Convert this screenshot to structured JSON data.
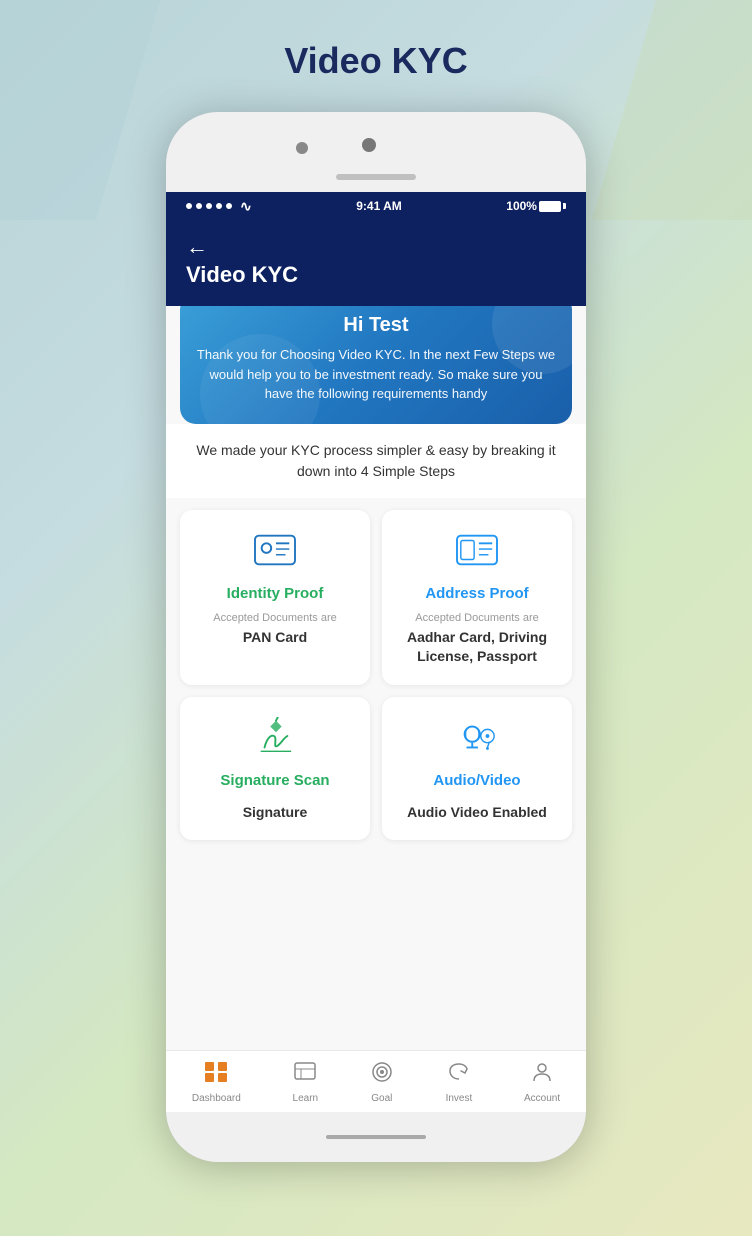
{
  "page": {
    "title": "Video KYC"
  },
  "status_bar": {
    "signal": "•••••",
    "wifi": "wifi",
    "time": "9:41 AM",
    "battery": "100%"
  },
  "header": {
    "back_label": "←",
    "title": "Video KYC"
  },
  "greeting": {
    "name": "Hi Test",
    "message": "Thank you for Choosing Video KYC. In the next Few Steps we would help you to be investment ready. So make sure you have the following requirements handy"
  },
  "steps_description": "We made your KYC process simpler & easy by breaking it down into 4 Simple Steps",
  "steps": [
    {
      "id": "identity",
      "title": "Identity Proof",
      "docs_label": "Accepted Documents are",
      "docs_value": "PAN Card",
      "color": "green"
    },
    {
      "id": "address",
      "title": "Address Proof",
      "docs_label": "Accepted Documents are",
      "docs_value": "Aadhar Card, Driving License, Passport",
      "color": "blue"
    },
    {
      "id": "signature",
      "title": "Signature Scan",
      "docs_label": "",
      "docs_value": "Signature",
      "color": "green"
    },
    {
      "id": "audio_video",
      "title": "Audio/Video",
      "docs_label": "",
      "docs_value": "Audio Video Enabled",
      "color": "blue"
    }
  ],
  "bottom_nav": [
    {
      "id": "dashboard",
      "label": "Dashboard",
      "icon": "dashboard",
      "active": true
    },
    {
      "id": "learn",
      "label": "Learn",
      "icon": "learn",
      "active": false
    },
    {
      "id": "goal",
      "label": "Goal",
      "icon": "goal",
      "active": false
    },
    {
      "id": "invest",
      "label": "Invest",
      "icon": "invest",
      "active": false
    },
    {
      "id": "account",
      "label": "Account",
      "icon": "account",
      "active": false
    }
  ]
}
